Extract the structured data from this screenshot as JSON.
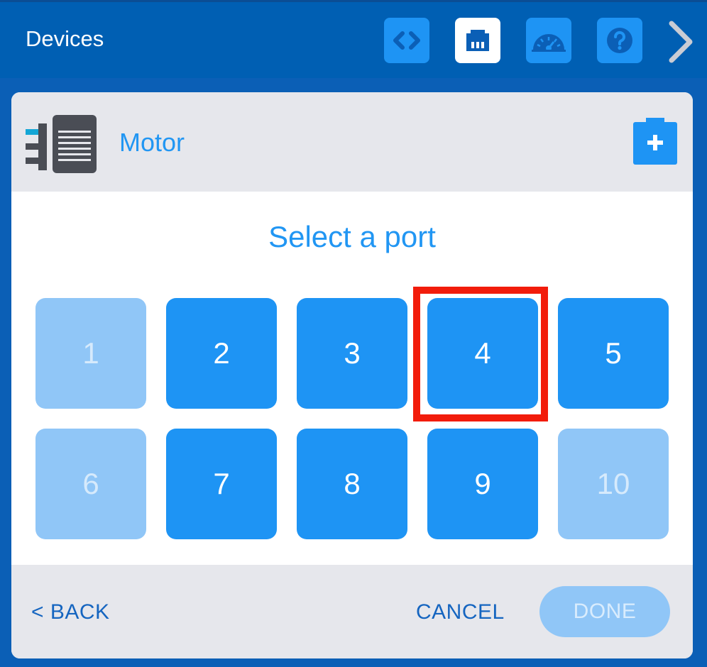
{
  "header": {
    "title": "Devices",
    "buttons": [
      {
        "name": "code-icon",
        "active": false
      },
      {
        "name": "port-icon",
        "active": true
      },
      {
        "name": "dashboard-icon",
        "active": false
      },
      {
        "name": "help-icon",
        "active": false
      }
    ],
    "next_icon": "chevron-right-icon"
  },
  "device": {
    "name": "Motor",
    "icon": "motor-icon",
    "add_icon": "add-battery-icon"
  },
  "prompt": "Select a port",
  "ports": [
    {
      "label": "1",
      "enabled": false
    },
    {
      "label": "2",
      "enabled": true
    },
    {
      "label": "3",
      "enabled": true
    },
    {
      "label": "4",
      "enabled": true,
      "highlighted": true
    },
    {
      "label": "5",
      "enabled": true
    },
    {
      "label": "6",
      "enabled": false
    },
    {
      "label": "7",
      "enabled": true
    },
    {
      "label": "8",
      "enabled": true
    },
    {
      "label": "9",
      "enabled": true
    },
    {
      "label": "10",
      "enabled": false
    }
  ],
  "footer": {
    "back_label": "< BACK",
    "cancel_label": "CANCEL",
    "done_label": "DONE",
    "done_enabled": false
  },
  "colors": {
    "header_bg": "#005fb3",
    "accent": "#1e94f4",
    "disabled": "#90c6f7",
    "highlight": "#f21c0b",
    "text_blue": "#2196f3",
    "link_blue": "#1565c0"
  }
}
